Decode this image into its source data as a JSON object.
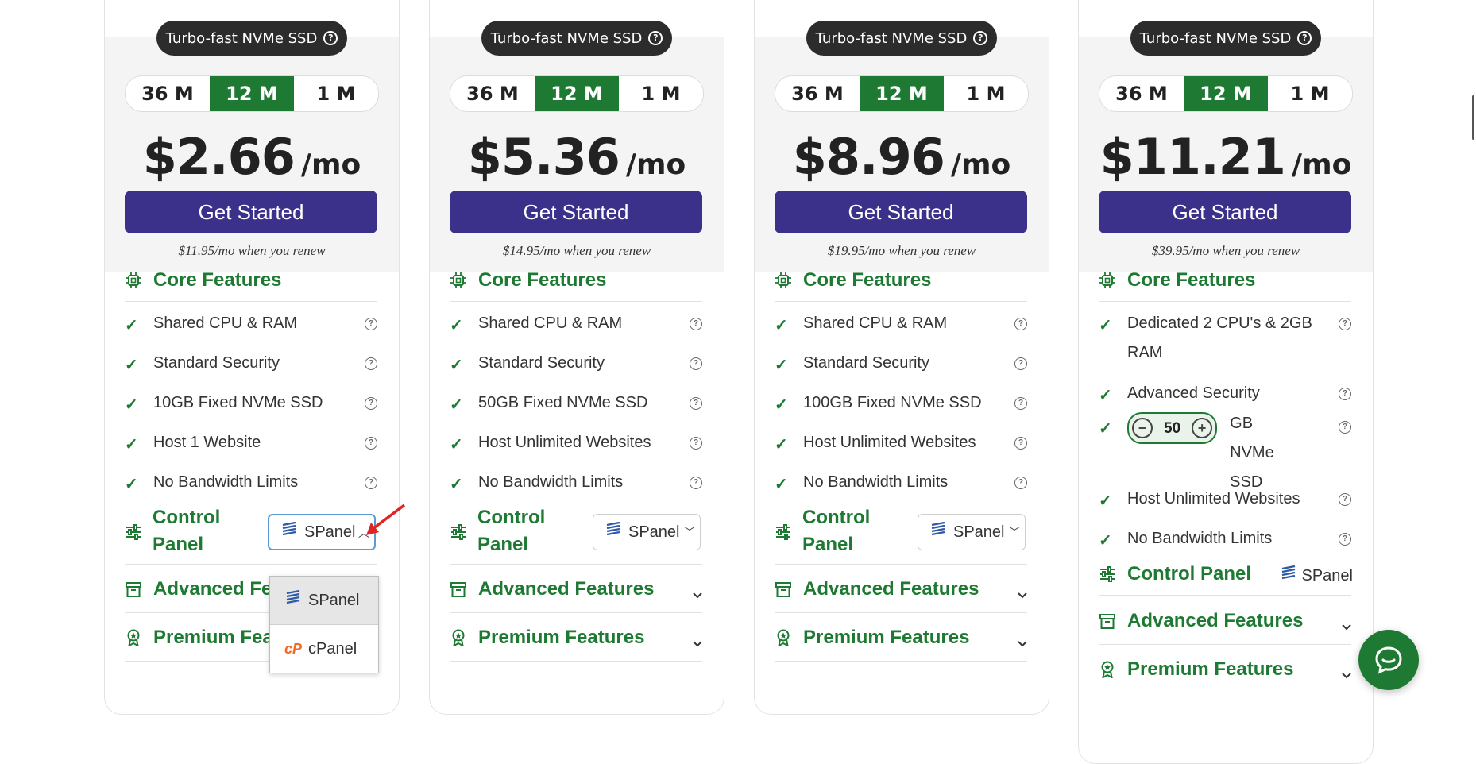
{
  "plans": [
    {
      "badge": "Turbo-fast NVMe SSD",
      "terms": [
        "36 M",
        "12 M",
        "1 M"
      ],
      "active_term": "12 M",
      "price": "$2.66",
      "per": "/mo",
      "cta": "Get Started",
      "renew": "$11.95/mo when you renew",
      "core_title": "Core Features",
      "features": [
        "Shared CPU & RAM",
        "Standard Security",
        "10GB Fixed NVMe SSD",
        "Host 1 Website",
        "No Bandwidth Limits"
      ],
      "control_panel_label": "Control Panel",
      "control_panel_value": "SPanel",
      "advanced_title": "Advanced Features",
      "premium_title": "Premium Features"
    },
    {
      "badge": "Turbo-fast NVMe SSD",
      "terms": [
        "36 M",
        "12 M",
        "1 M"
      ],
      "active_term": "12 M",
      "price": "$5.36",
      "per": "/mo",
      "cta": "Get Started",
      "renew": "$14.95/mo when you renew",
      "core_title": "Core Features",
      "features": [
        "Shared CPU & RAM",
        "Standard Security",
        "50GB Fixed NVMe SSD",
        "Host Unlimited Websites",
        "No Bandwidth Limits"
      ],
      "control_panel_label": "Control Panel",
      "control_panel_value": "SPanel",
      "advanced_title": "Advanced Features",
      "premium_title": "Premium Features"
    },
    {
      "badge": "Turbo-fast NVMe SSD",
      "terms": [
        "36 M",
        "12 M",
        "1 M"
      ],
      "active_term": "12 M",
      "price": "$8.96",
      "per": "/mo",
      "cta": "Get Started",
      "renew": "$19.95/mo when you renew",
      "core_title": "Core Features",
      "features": [
        "Shared CPU & RAM",
        "Standard Security",
        "100GB Fixed NVMe SSD",
        "Host Unlimited Websites",
        "No Bandwidth Limits"
      ],
      "control_panel_label": "Control Panel",
      "control_panel_value": "SPanel",
      "advanced_title": "Advanced Features",
      "premium_title": "Premium Features"
    },
    {
      "badge": "Turbo-fast NVMe SSD",
      "terms": [
        "36 M",
        "12 M",
        "1 M"
      ],
      "active_term": "12 M",
      "price": "$11.21",
      "per": "/mo",
      "cta": "Get Started",
      "renew": "$39.95/mo when you renew",
      "core_title": "Core Features",
      "features": [
        "Dedicated 2 CPU's & 2GB RAM",
        "Advanced Security",
        "GB NVMe SSD",
        "Host Unlimited Websites",
        "No Bandwidth Limits"
      ],
      "storage_value": "50",
      "control_panel_label": "Control Panel",
      "control_panel_value": "SPanel",
      "advanced_title": "Advanced Features",
      "premium_title": "Premium Features"
    }
  ],
  "dropdown_options": [
    "SPanel",
    "cPanel"
  ],
  "colors": {
    "green": "#1e7a33",
    "purple": "#3b318a",
    "badge_bg": "#2c2c2c",
    "annotation_red": "#e02424"
  },
  "icons": {
    "help": "question-circle-icon",
    "check": "check-icon",
    "chip": "cpu-chip-icon",
    "sliders": "sliders-icon",
    "archive": "archive-box-icon",
    "award": "award-badge-icon",
    "chat": "chat-bubble-icon"
  }
}
